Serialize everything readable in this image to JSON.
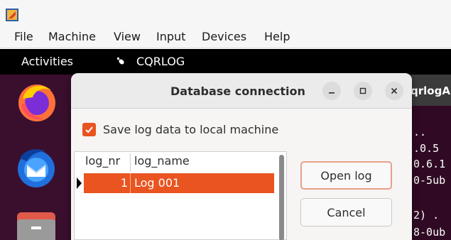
{
  "vbox": {
    "menu": [
      "File",
      "Machine",
      "View",
      "Input",
      "Devices",
      "Help"
    ]
  },
  "gnome": {
    "activities": "Activities",
    "app_name": "CQRLOG"
  },
  "terminal": {
    "title_fragment": "qrlogA",
    "lines": [
      "..",
      ".0.5",
      "0.6.1",
      "0-5ub",
      "2) .",
      "8-0ub"
    ]
  },
  "dialog": {
    "title": "Database connection",
    "save_local_label": "Save log data to local machine",
    "save_local_checked": true,
    "columns": {
      "log_nr": "log_nr",
      "log_name": "log_name"
    },
    "rows": [
      {
        "log_nr": "1",
        "log_name": "Log 001"
      }
    ],
    "open_button": "Open log",
    "cancel_button": "Cancel"
  },
  "colors": {
    "accent": "#e95420",
    "gnome_bar": "#000000",
    "terminal_bg": "#300a24"
  },
  "icons": [
    "virtualbox-icon",
    "firefox-icon",
    "thunderbird-icon",
    "files-icon",
    "cqrlog-icon",
    "minimize-icon",
    "maximize-icon",
    "close-icon",
    "checkmark-icon",
    "row-pointer-icon"
  ]
}
